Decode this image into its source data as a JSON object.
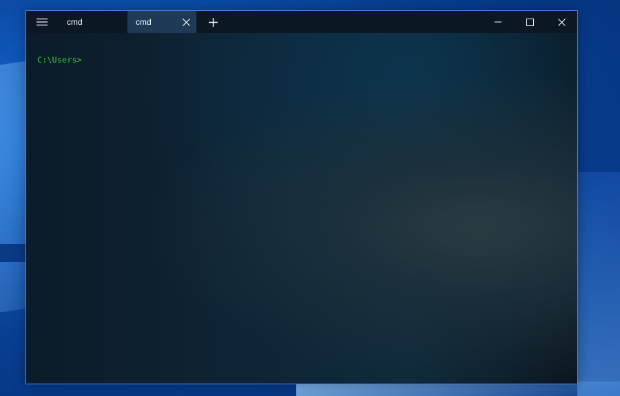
{
  "window": {
    "tabs": [
      {
        "label": "cmd",
        "active": false
      },
      {
        "label": "cmd",
        "active": true
      }
    ],
    "icons": {
      "menu": "hamburger-menu-icon",
      "close_tab": "close-icon",
      "new_tab": "plus-icon",
      "minimize": "minimize-icon",
      "maximize": "maximize-icon",
      "close_window": "close-icon"
    }
  },
  "console": {
    "prompt": "C:\\Users>"
  },
  "colors": {
    "prompt_text": "#2fd12f",
    "active_tab": "#1e3a56",
    "window_border": "#4a8ee6",
    "titlebar": "#0b1824"
  }
}
